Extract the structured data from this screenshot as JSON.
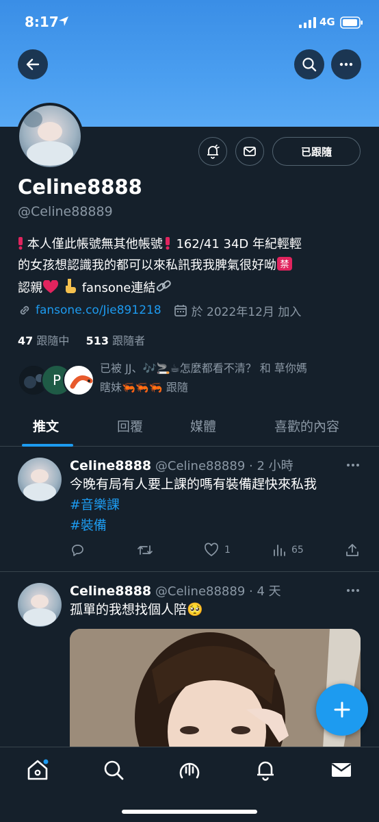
{
  "status_bar": {
    "time": "8:17",
    "network": "4G"
  },
  "profile": {
    "name": "Celine8888",
    "handle": "@Celine88889",
    "bio_line1": " 本人僅此帳號無其他帳號",
    "bio_line1b": " 162/41 34D 年紀輕輕",
    "bio_line2": "的女孩想認識我的都可以來私訊我我脾氣很好呦",
    "bio_line3a": "認親",
    "bio_line3b": " fansone連結",
    "link": "fansone.co/Jie891218",
    "joined": "於 2022年12月 加入",
    "following_count": "47",
    "following_label": "跟隨中",
    "followers_count": "513",
    "followers_label": "跟隨者",
    "follow_button": "已跟隨",
    "known_followers_line1": "已被 JJ、🎶🚬☕怎麼都看不清？ 和 草你媽",
    "known_followers_line2": "瞎妹🦐🦐🦐 跟隨"
  },
  "tabs": [
    {
      "label": "推文",
      "active": true
    },
    {
      "label": "回覆",
      "active": false
    },
    {
      "label": "媒體",
      "active": false
    },
    {
      "label": "喜歡的內容",
      "active": false
    }
  ],
  "tweets": [
    {
      "name": "Celine8888",
      "handle_time": "@Celine88889 · 2 小時",
      "text": "今晚有局有人要上課的嗎有裝備趕快來私我",
      "hashtags": [
        "#音樂課",
        "#裝備"
      ],
      "replies": "",
      "retweets": "",
      "likes": "1",
      "views": "65"
    },
    {
      "name": "Celine8888",
      "handle_time": "@Celine88889 · 4 天",
      "text": "孤單的我想找個人陪",
      "emoji": "🥺"
    }
  ],
  "colors": {
    "accent": "#1d9bf0",
    "background": "#15202b",
    "banner": "#4a9ef0",
    "secondary_text": "#8b98a5"
  },
  "icons": [
    "back-arrow-icon",
    "search-icon",
    "more-icon",
    "notification-bell-icon",
    "message-icon",
    "link-icon",
    "calendar-icon",
    "reply-icon",
    "retweet-icon",
    "like-icon",
    "views-icon",
    "share-icon",
    "compose-plus-icon",
    "home-icon",
    "explore-icon",
    "spaces-icon",
    "notifications-icon",
    "messages-icon"
  ]
}
